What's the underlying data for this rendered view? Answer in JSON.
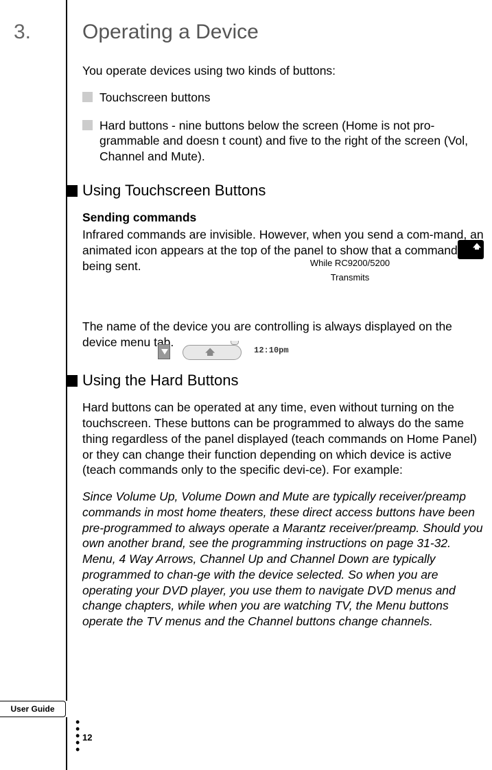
{
  "chapter": {
    "number": "3.",
    "title": "Operating a Device"
  },
  "intro": "You operate devices using two kinds of buttons:",
  "bullets": [
    "Touchscreen buttons",
    "Hard buttons - nine buttons below the screen (Home is not pro-grammable and doesn t count) and five to the right of the screen (Vol, Channel and Mute)."
  ],
  "section1": {
    "title": "Using Touchscreen Buttons",
    "subhead": "Sending commands",
    "para1": "Infrared commands are invisible. However, when you send a com-mand, an animated icon appears at the top of the panel to show that a command is being sent.",
    "caption_line1": "While RC9200/5200",
    "caption_line2": "Transmits",
    "para2_prefix": "The name of the device you are controlling is always displayed on the device menu tab.",
    "tab_time": "12:10pm"
  },
  "section2": {
    "title": "Using the Hard Buttons",
    "para1": "Hard buttons can be operated at any time, even without turning on the touchscreen. These buttons can be programmed to always do the same thing regardless of the panel displayed (teach commands on Home Panel) or they can change their function depending on which device is active (teach commands only to the specific devi-ce). For example:",
    "para2_italic": "Since Volume Up, Volume Down and Mute are typically receiver/preamp commands in most home theaters, these direct access buttons have been pre-programmed to always operate a Marantz receiver/preamp. Should you own another brand, see the programming instructions on page 31-32. Menu, 4 Way Arrows, Channel Up and Channel Down are typically programmed to chan-ge with the device selected. So when you are operating your DVD player, you use them to navigate DVD menus and change chapters, while when you are watching TV, the Menu buttons operate the TV menus and the Channel buttons change channels."
  },
  "footer": {
    "tab": "User Guide",
    "page": "12"
  }
}
